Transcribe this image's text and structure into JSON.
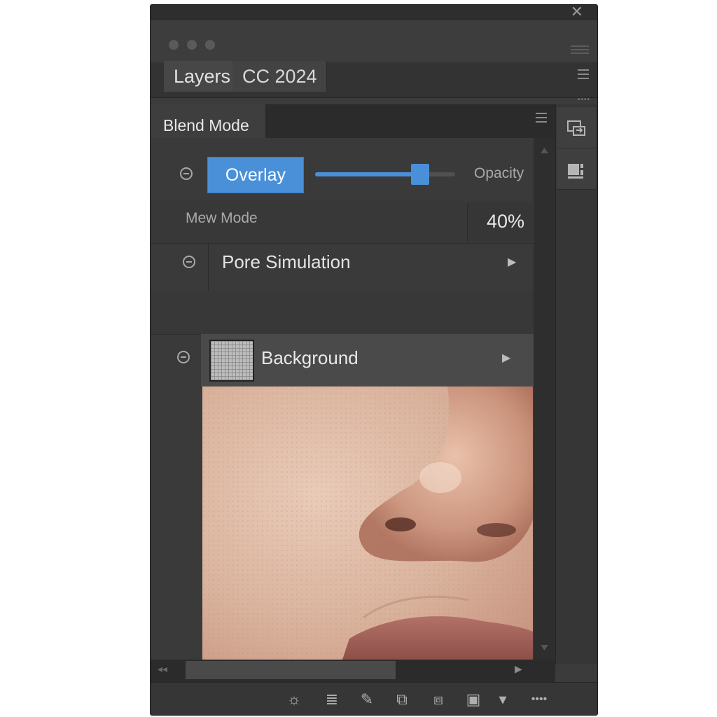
{
  "window": {
    "close_glyph": "✕",
    "tabs": [
      {
        "label": "Layers"
      },
      {
        "label": "CC 2024"
      }
    ],
    "menu_icon": "panel-menu-icon",
    "more_dots": "••••"
  },
  "panel": {
    "subtab_label": "Blend Mode",
    "blend_row": {
      "mode_label": "Overlay",
      "slider_value_fraction": 0.75,
      "opacity_label": "Opacity"
    },
    "mode_row": {
      "label": "Mew Mode",
      "value": "40%"
    },
    "layers": [
      {
        "name": "Pore Simulation",
        "expand_glyph": "▶"
      },
      {
        "name": "Background",
        "expand_glyph": "▶"
      }
    ]
  },
  "side_tools": [
    "arrange-icon",
    "align-icon"
  ],
  "bottom_tools": [
    {
      "icon": "sun-icon",
      "glyph": "☼"
    },
    {
      "icon": "list-icon",
      "glyph": "≣"
    },
    {
      "icon": "brush-icon",
      "glyph": "✎"
    },
    {
      "icon": "frame-icon",
      "glyph": "⧉"
    },
    {
      "icon": "link-icon",
      "glyph": "⧈"
    },
    {
      "icon": "mask-icon",
      "glyph": "▣"
    },
    {
      "icon": "chevron-down-icon",
      "glyph": "▾"
    },
    {
      "icon": "more-icon",
      "glyph": "••••"
    }
  ],
  "colors": {
    "accent": "#4a90d9",
    "panel_bg": "#3b3b3b"
  }
}
